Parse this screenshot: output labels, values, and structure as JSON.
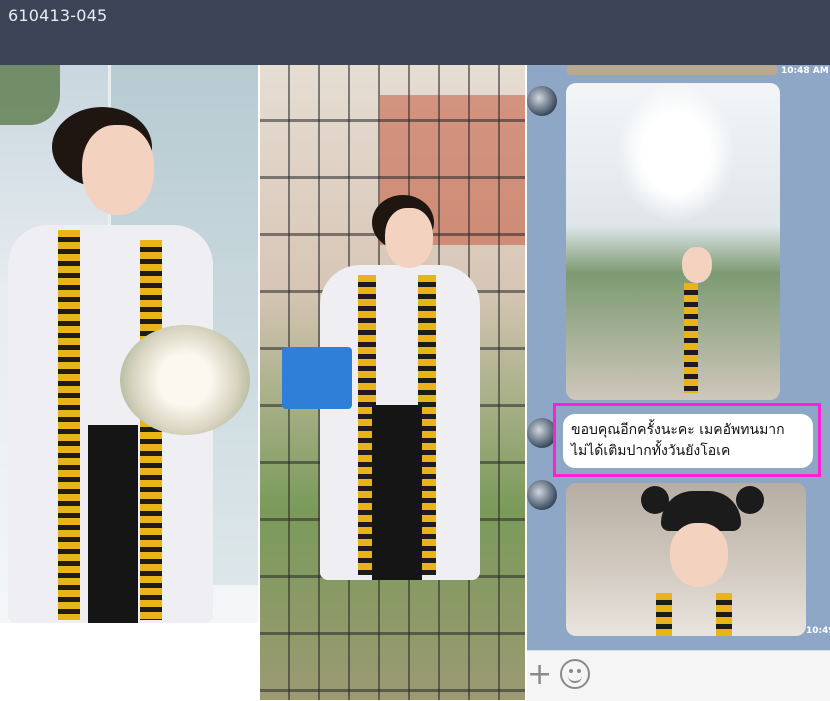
{
  "window": {
    "title": "610413-045"
  },
  "chat": {
    "timestamps": [
      "10:48 AM",
      "10:49"
    ],
    "highlighted_message": {
      "line1": "ขอบคุณอีกครั้งนะคะ เมคอัพทนมาก",
      "line2": "ไม่ได้เติมปากทั้งวันยังโอเค"
    },
    "highlight_color": "#ff1fd6"
  },
  "composer": {
    "icons": [
      "plus-icon",
      "emoji-icon"
    ]
  }
}
